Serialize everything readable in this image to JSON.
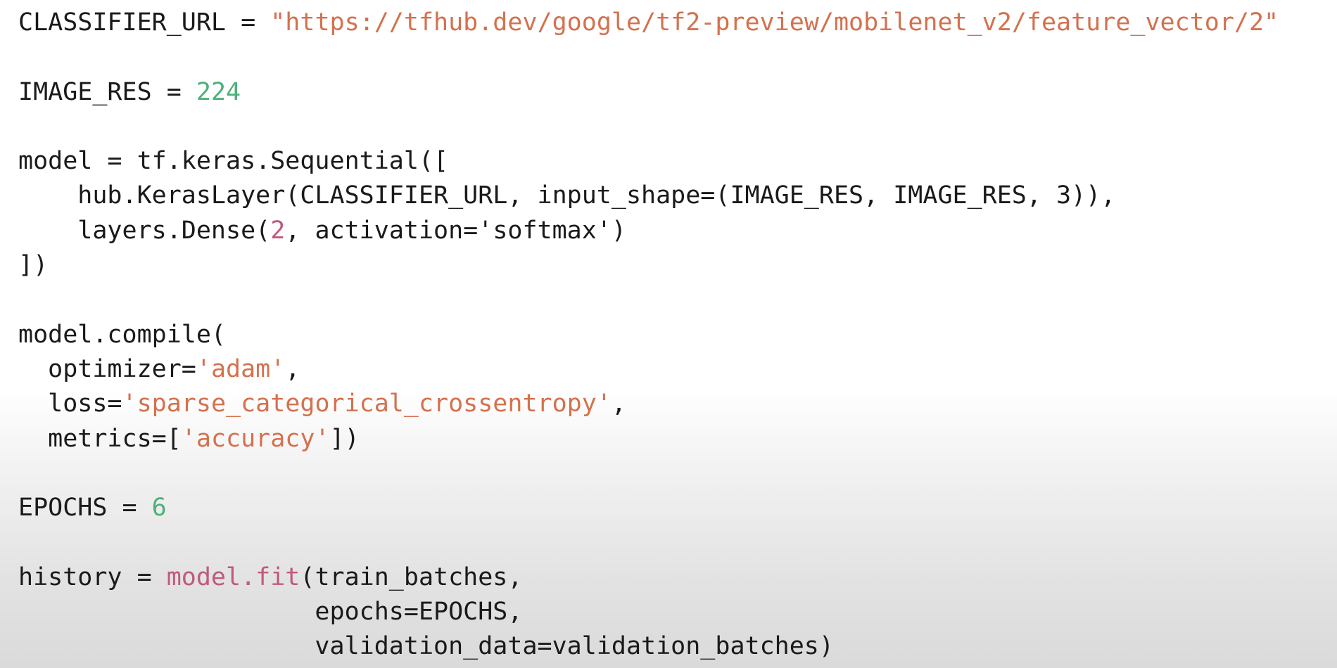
{
  "colors": {
    "text": "#1a1a1a",
    "string": "#d4714e",
    "number_green": "#4fb07a",
    "number_pink": "#c05a7c"
  },
  "code": {
    "l01_a": "CLASSIFIER_URL = ",
    "l01_str": "\"https://tfhub.dev/google/tf2-preview/mobilenet_v2/feature_vector/2\"",
    "l03_a": "IMAGE_RES = ",
    "l03_num": "224",
    "l05": "model = tf.keras.Sequential([",
    "l06": "    hub.KerasLayer(CLASSIFIER_URL, input_shape=(IMAGE_RES, IMAGE_RES, 3)),",
    "l07_a": "    layers.Dense(",
    "l07_num": "2",
    "l07_b": ", activation='softmax')",
    "l08": "])",
    "l10": "model.compile(",
    "l11_a": "  optimizer=",
    "l11_str": "'adam'",
    "l11_b": ",",
    "l12_a": "  loss=",
    "l12_str": "'sparse_categorical_crossentropy'",
    "l12_b": ",",
    "l13_a": "  metrics=[",
    "l13_str": "'accuracy'",
    "l13_b": "])",
    "l15_a": "EPOCHS = ",
    "l15_num": "6",
    "l17_a": "history = ",
    "l17_fn": "model.fit",
    "l17_b": "(train_batches,",
    "l18": "                    epochs=EPOCHS,",
    "l19": "                    validation_data=validation_batches)"
  }
}
